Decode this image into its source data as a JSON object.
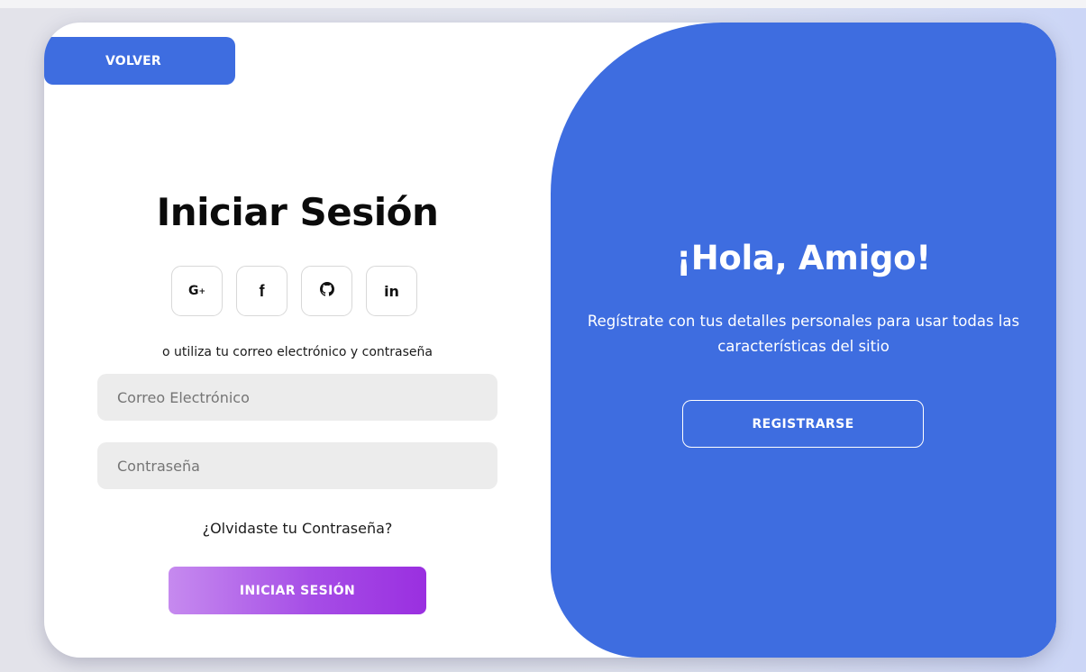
{
  "nav": {
    "back_label": "VOLVER"
  },
  "login": {
    "title": "Iniciar Sesión",
    "social": [
      {
        "icon": "google-plus-icon",
        "glyph": "G+"
      },
      {
        "icon": "facebook-icon",
        "glyph": "f"
      },
      {
        "icon": "github-icon",
        "glyph": "github"
      },
      {
        "icon": "linkedin-icon",
        "glyph": "in"
      }
    ],
    "hint": "o utiliza tu correo electrónico y contraseña",
    "email_placeholder": "Correo Electrónico",
    "password_placeholder": "Contraseña",
    "forgot_label": "¿Olvidaste tu Contraseña?",
    "submit_label": "INICIAR SESIÓN"
  },
  "welcome": {
    "title": "¡Hola, Amigo!",
    "text": "Regístrate con tus detalles personales para usar todas las características del sitio",
    "register_label": "REGISTRARSE"
  },
  "colors": {
    "accent": "#3e6de0",
    "gradient_start": "#c68aef",
    "gradient_end": "#9a2fe0",
    "input_bg": "#ececec"
  }
}
